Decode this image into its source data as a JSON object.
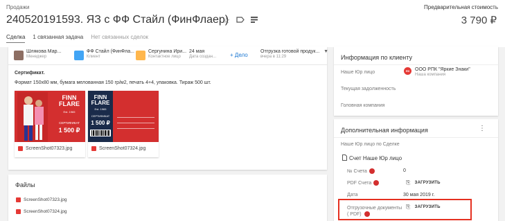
{
  "header": {
    "breadcrumb": "Продажи",
    "title": "240520191593. ЯЗ с ФФ Стайл (ФинФлаер)",
    "price_label": "Предварительная стоимость",
    "price": "3 790 ₽",
    "icons": [
      "star-icon",
      "tag-icon",
      "list-icon"
    ]
  },
  "tabs": [
    {
      "label": "Сделка",
      "active": true
    },
    {
      "label": "1 связанная задача",
      "active": false
    },
    {
      "label": "Нет связанных сделок",
      "active": false
    }
  ],
  "people": [
    {
      "name": "Шлякова Мар...",
      "role": "Менеджер"
    },
    {
      "name": "ФФ Стайл (ФинФла...",
      "role": "Клиент"
    },
    {
      "name": "Сергунина Ири...",
      "role": "Контактное лицо"
    },
    {
      "name": "24 мая",
      "role": "Дата создан..."
    }
  ],
  "add_deal": "+ Дело",
  "status": {
    "name": "Отгрузка готовой продук...",
    "sub": "вчера в 11:29"
  },
  "description": {
    "title": "Сертификат.",
    "text": "Формат 150х80 мм, бумага мелованная 150 гр/м2, печать 4+4, упаковка. Тираж 500 шт."
  },
  "attachments": [
    {
      "filename": "ScreenShot07323.jpg",
      "brand": "FINN FLARE",
      "est": "Est. 1965",
      "cert": "СЕРТИФИКАТ",
      "amount": "1 500 ₽"
    },
    {
      "filename": "ScreenShot07324.jpg",
      "brand": "FINN FLARE",
      "est": "Est. 1965",
      "cert": "СЕРТИФИКАТ",
      "amount": "1 500 ₽"
    }
  ],
  "files": {
    "title": "Файлы",
    "items": [
      "ScreenShot07323.jpg",
      "ScreenShot07324.jpg"
    ]
  },
  "client_info": {
    "title": "Информация по клиенту",
    "our_legal_label": "Наше Юр лицо",
    "company_name": "ООО РПК \"Яркие Знаки\"",
    "company_role": "Наша компания",
    "company_logo": "ЯЗ",
    "debt_label": "Текущая задолженность",
    "head_label": "Головная компания"
  },
  "extra_info": {
    "title": "Дополнительная информация",
    "our_legal_deal_label": "Наше Юр лицо по Сделке",
    "account_label": "Счет Наше Юр лицо",
    "invoice_no_label": "№ Счета",
    "invoice_no_value": "0",
    "pdf_invoice_label": "PDF Счета",
    "upload_label": "ЗАГРУЗИТЬ",
    "date_label": "Дата",
    "date_value": "30 мая 2019 г.",
    "shipping_docs_label": "Отгрузочные документы ( PDF)"
  },
  "colors": {
    "accent": "#1976d2",
    "required": "#d32f2f",
    "highlight": "#e53020",
    "brand_red": "#d32f2f",
    "brand_navy": "#1a2b4a"
  }
}
